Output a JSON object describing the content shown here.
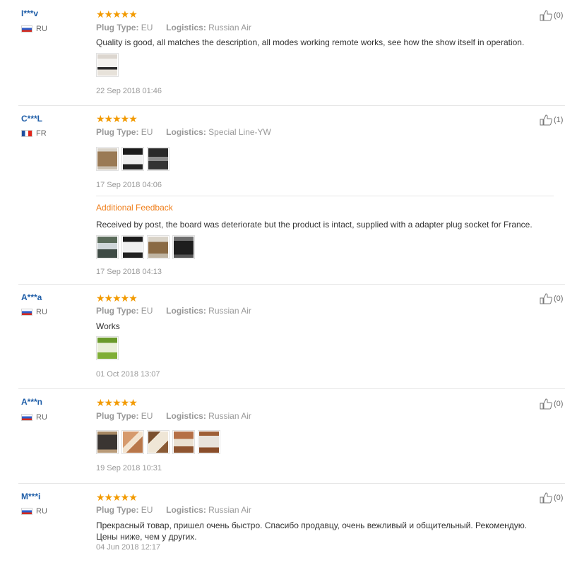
{
  "labels": {
    "plug_type": "Plug Type:",
    "logistics": "Logistics:",
    "additional_feedback": "Additional Feedback",
    "stars": "★★★★★"
  },
  "colors": {
    "username": "#1f5ea8",
    "star": "#f29a00",
    "additional": "#ef7e1a",
    "meta": "#999999"
  },
  "reviews": [
    {
      "user": "I***v",
      "country": "RU",
      "flag_icon": "russia-flag-icon",
      "rating": 5,
      "plug_type": "EU",
      "logistics": "Russian Air",
      "text": "Quality is good, all matches the description, all modes working remote works, see how the show itself in operation.",
      "photo_count": 1,
      "date": "22 Sep 2018 01:46",
      "helpful": "(0)"
    },
    {
      "user": "C***L",
      "country": "FR",
      "flag_icon": "france-flag-icon",
      "rating": 5,
      "plug_type": "EU",
      "logistics": "Special Line-YW",
      "text": "",
      "photo_count": 3,
      "date": "17 Sep 2018 04:06",
      "helpful": "(1)",
      "additional": {
        "text": "Received by post, the board was deteriorate but the product is intact, supplied with a adapter plug socket for France.",
        "photo_count": 4,
        "date": "17 Sep 2018 04:13"
      }
    },
    {
      "user": "A***a",
      "country": "RU",
      "flag_icon": "russia-flag-icon",
      "rating": 5,
      "plug_type": "EU",
      "logistics": "Russian Air",
      "text": "Works",
      "photo_count": 1,
      "date": "01 Oct 2018 13:07",
      "helpful": "(0)"
    },
    {
      "user": "A***n",
      "country": "RU",
      "flag_icon": "russia-flag-icon",
      "rating": 5,
      "plug_type": "EU",
      "logistics": "Russian Air",
      "text": "",
      "photo_count": 5,
      "date": "19 Sep 2018 10:31",
      "helpful": "(0)"
    },
    {
      "user": "M***i",
      "country": "RU",
      "flag_icon": "russia-flag-icon",
      "rating": 5,
      "plug_type": "EU",
      "logistics": "Russian Air",
      "text": "Прекрасный товар, пришел очень быстро. Спасибо продавцу, очень вежливый и общительный. Рекомендую. Цены ниже, чем у других.",
      "photo_count": 0,
      "date": "04 Jun 2018 12:17",
      "helpful": "(0)"
    }
  ]
}
